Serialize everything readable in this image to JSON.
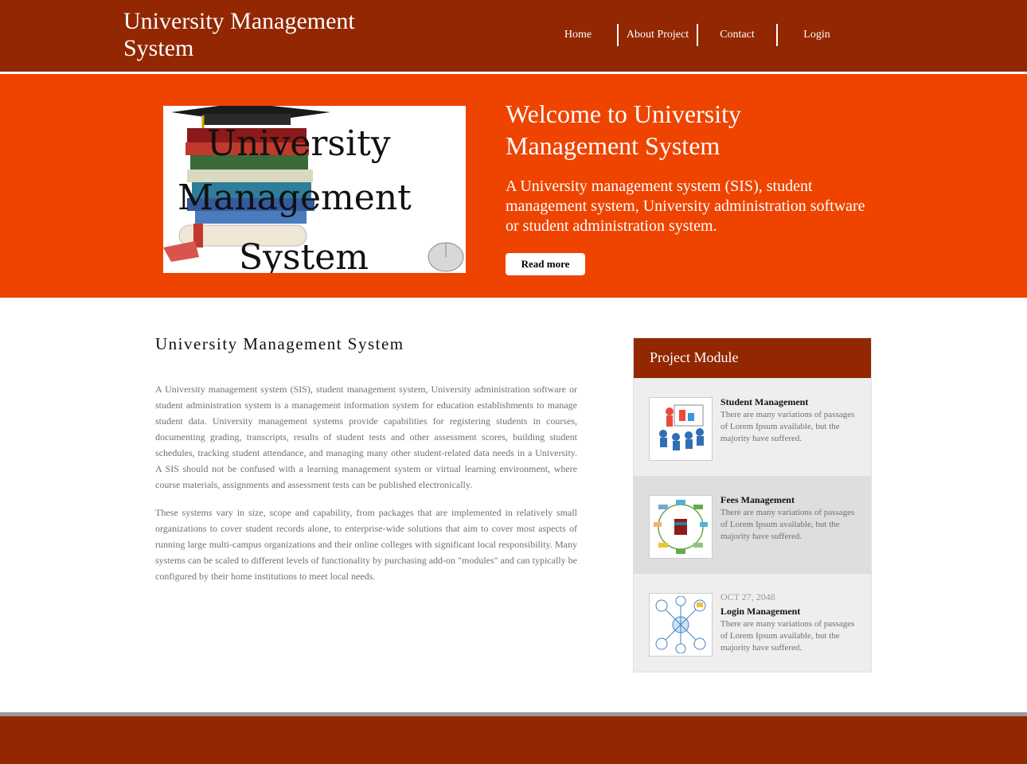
{
  "header": {
    "site_title": "University Management System",
    "nav": [
      "Home",
      "About Project",
      "Contact",
      "Login"
    ]
  },
  "hero": {
    "image_text": [
      "University",
      "Management",
      "System"
    ],
    "title": "Welcome to University Management System",
    "text": "A University management system (SIS), student management system, University administration software or student administration system.",
    "button": "Read more"
  },
  "content": {
    "title": "University Management System",
    "paragraphs": [
      "A University management system (SIS), student management system, University administration software or student administration system is a management information system for education establishments to manage student data. University management systems provide capabilities for registering students in courses, documenting grading, transcripts, results of student tests and other assessment scores, building student schedules, tracking student attendance, and managing many other student-related data needs in a University. A SIS should not be confused with a learning management system or virtual learning environment, where course materials, assignments and assessment tests can be published electronically.",
      "These systems vary in size, scope and capability, from packages that are implemented in relatively small organizations to cover student records alone, to enterprise-wide solutions that aim to cover most aspects of running large multi-campus organizations and their online colleges with significant local responsibility. Many systems can be scaled to different levels of functionality by purchasing add-on \"modules\" and can typically be configured by their home institutions to meet local needs."
    ]
  },
  "sidebar": {
    "title": "Project Module",
    "modules": [
      {
        "date": "",
        "title": "Student Management",
        "text": "There are many variations of passages of Lorem Ipsum available, but the majority have suffered.",
        "icon": "students-presentation-icon"
      },
      {
        "date": "",
        "title": "Fees Management",
        "text": "There are many variations of passages of Lorem Ipsum available, but the majority have suffered.",
        "icon": "fees-diagram-icon"
      },
      {
        "date": "OCT 27, 2048",
        "title": "Login Management",
        "text": "There are many variations of passages of Lorem Ipsum available, but the majority have suffered.",
        "icon": "login-network-icon"
      }
    ]
  },
  "colors": {
    "header_bg": "#922701",
    "hero_bg": "#ee4400",
    "footer_bg": "#922701"
  }
}
